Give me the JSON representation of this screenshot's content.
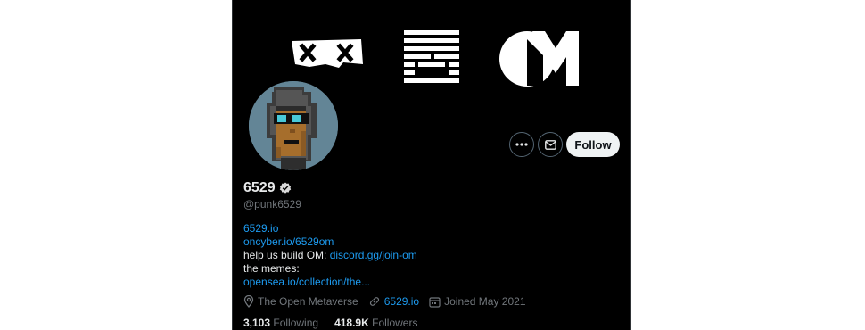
{
  "profile": {
    "display_name": "6529",
    "handle": "@punk6529",
    "verified_icon": "verified-badge-icon",
    "bio": {
      "link1": "6529.io",
      "link2": "oncyber.io/6529om",
      "line3_text": "help us build OM: ",
      "line3_link": "discord.gg/join-om",
      "line4_text": "the memes:",
      "link5": "opensea.io/collection/the..."
    },
    "meta": {
      "location": "The Open Metaverse",
      "website": "6529.io",
      "joined": "Joined May 2021"
    },
    "stats": {
      "following_count": "3,103",
      "following_label": "Following",
      "followers_count": "418.9K",
      "followers_label": "Followers"
    }
  },
  "actions": {
    "follow_label": "Follow",
    "more_icon": "more-dots-icon",
    "message_icon": "envelope-icon"
  },
  "colors": {
    "background": "#000000",
    "link": "#1d9bf0",
    "text": "#e7e9ea",
    "muted": "#71767b",
    "avatar_bg": "#638596"
  }
}
